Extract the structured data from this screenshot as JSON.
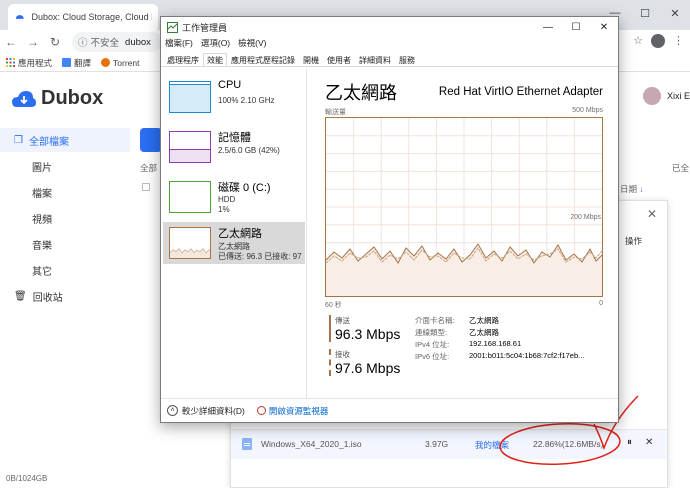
{
  "browser": {
    "tab_title": "Dubox: Cloud Storage, Cloud B",
    "security_label": "不安全",
    "url": "dubox",
    "bookmarks": [
      "應用程式",
      "翻譯",
      "Torrent"
    ]
  },
  "dubox": {
    "logo": "Dubox",
    "user_name": "Xixi E",
    "sidebar": [
      {
        "label": "全部檔案",
        "active": true,
        "main": true
      },
      {
        "label": "圖片"
      },
      {
        "label": "檔案"
      },
      {
        "label": "視頻"
      },
      {
        "label": "音樂"
      },
      {
        "label": "其它"
      },
      {
        "label": "回收站",
        "main": true
      }
    ],
    "quota": "0B/1024GB",
    "bg_texts": {
      "all_label": "全部",
      "right_label": "已全",
      "date_col": "日期"
    },
    "transfer": {
      "action_col": "操作",
      "file_name": "Windows_X64_2020_1.iso",
      "file_size": "3.97G",
      "location": "我的檔案",
      "progress": "22.86%(12.6MB/s)"
    }
  },
  "task_manager": {
    "title": "工作管理員",
    "menu": [
      "檔案(F)",
      "選項(O)",
      "檢視(V)"
    ],
    "tabs": [
      "處理程序",
      "效能",
      "應用程式歷程記錄",
      "開機",
      "使用者",
      "詳細資料",
      "服務"
    ],
    "active_tab": 1,
    "resources": [
      {
        "name": "CPU",
        "lines": [
          "100% 2.10 GHz"
        ],
        "color": "#1b8cc9"
      },
      {
        "name": "記憶體",
        "lines": [
          "2.5/6.0 GB (42%)"
        ],
        "color": "#8b3fa8"
      },
      {
        "name": "磁碟 0 (C:)",
        "lines": [
          "HDD",
          "1%"
        ],
        "color": "#4da635"
      },
      {
        "name": "乙太網路",
        "lines": [
          "乙太網路",
          "已傳送: 96.3 已接收: 97"
        ],
        "color": "#a5744a",
        "active": true
      }
    ],
    "heading": "乙太網路",
    "adapter": "Red Hat VirtIO Ethernet Adapter",
    "graph": {
      "throughput_label": "輸送量",
      "max_label": "500 Mbps",
      "mid_label": "200 Mbps",
      "left_label": "60 秒",
      "right_label": "0"
    },
    "send_label": "傳送",
    "send_value": "96.3 Mbps",
    "recv_label": "接收",
    "recv_value": "97.6 Mbps",
    "info": [
      {
        "k": "介面卡名稱:",
        "v": "乙太網路"
      },
      {
        "k": "連線類型:",
        "v": "乙太網路"
      },
      {
        "k": "IPv4 位址:",
        "v": "192.168.168.61"
      },
      {
        "k": "IPv6 位址:",
        "v": "2001:b011:5c04:1b68:7cf2:f17eb..."
      }
    ],
    "footer_less": "較少詳細資料(D)",
    "footer_monitor": "開啟資源監視器"
  }
}
